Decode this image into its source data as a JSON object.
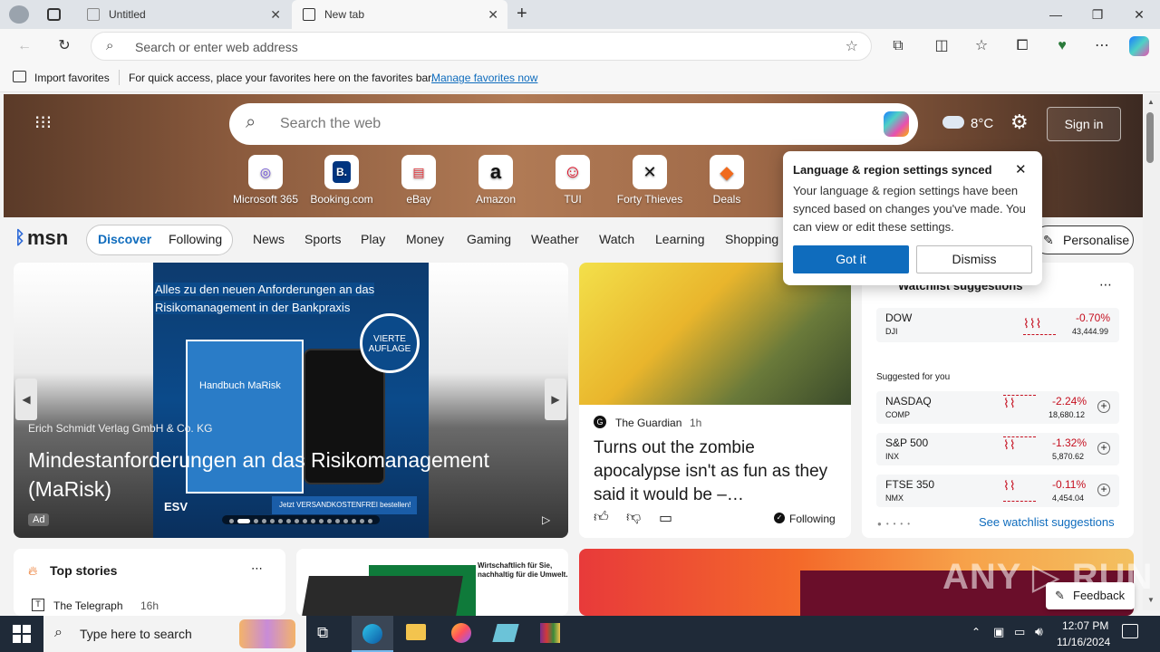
{
  "browser": {
    "tabs": [
      {
        "title": "Untitled"
      },
      {
        "title": "New tab"
      }
    ],
    "address_placeholder": "Search or enter web address"
  },
  "favbar": {
    "import": "Import favorites",
    "hint": "For quick access, place your favorites here on the favorites bar.",
    "manage": "Manage favorites now"
  },
  "msn": {
    "search_placeholder": "Search the web",
    "weather": "8°C",
    "sign_in": "Sign in",
    "quicklinks": [
      {
        "label": "Microsoft 365",
        "glyph": "◎"
      },
      {
        "label": "Booking.com",
        "glyph": "B."
      },
      {
        "label": "eBay",
        "glyph": "▤"
      },
      {
        "label": "Amazon",
        "glyph": "a"
      },
      {
        "label": "TUI",
        "glyph": "☺"
      },
      {
        "label": "Forty Thieves",
        "glyph": "✕"
      },
      {
        "label": "Deals",
        "glyph": "◆"
      }
    ],
    "logo": "msn",
    "discover": "Discover",
    "following": "Following",
    "nav": [
      "News",
      "Sports",
      "Play",
      "Money",
      "Gaming",
      "Weather",
      "Watch",
      "Learning",
      "Shopping"
    ],
    "personalise": "Personalise"
  },
  "popup": {
    "title": "Language & region settings synced",
    "body": "Your language & region settings have been synced based on changes you've made. You can view or edit these settings.",
    "got_it": "Got it",
    "dismiss": "Dismiss"
  },
  "ad": {
    "banner_l1": "Alles zu den neuen Anforderungen an das",
    "banner_l2": "Risikomanagement in der Bankpraxis",
    "badge": "VIERTE AUFLAGE",
    "book": "Handbuch MaRisk",
    "sponsor": "Erich Schmidt Verlag GmbH & Co. KG",
    "title": "Mindestanforderungen an das Risikomanagement (MaRisk)",
    "ad_label": "Ad",
    "promo": "Jetzt VERSANDKOSTENFREI bestellen!",
    "esv": "ESV"
  },
  "article": {
    "source": "The Guardian",
    "time": "1h",
    "title": "Turns out the zombie apocalypse isn't as fun as they said it would be –…",
    "following": "Following"
  },
  "watchlist": {
    "title": "Watchlist suggestions",
    "dow": {
      "name": "DOW",
      "sym": "DJI",
      "change": "-0.70%",
      "price": "43,444.99"
    },
    "suggested": "Suggested for you",
    "stocks": [
      {
        "name": "NASDAQ",
        "sym": "COMP",
        "change": "-2.24%",
        "price": "18,680.12"
      },
      {
        "name": "S&P 500",
        "sym": "INX",
        "change": "-1.32%",
        "price": "5,870.62"
      },
      {
        "name": "FTSE 350",
        "sym": "NMX",
        "change": "-0.11%",
        "price": "4,454.04"
      }
    ],
    "see": "See watchlist suggestions"
  },
  "top": {
    "title": "Top stories",
    "source": "The Telegraph",
    "time": "16h",
    "ad2_l1": "Wirtschaftlich für Sie,",
    "ad2_l2": "nachhaltig für die Umwelt."
  },
  "feedback": "Feedback",
  "taskbar": {
    "search": "Type here to search",
    "time": "12:07 PM",
    "date": "11/16/2024"
  },
  "colors": {
    "accent": "#0f6cbd",
    "red": "#c50f1f",
    "taskbar": "#1f2a38"
  }
}
